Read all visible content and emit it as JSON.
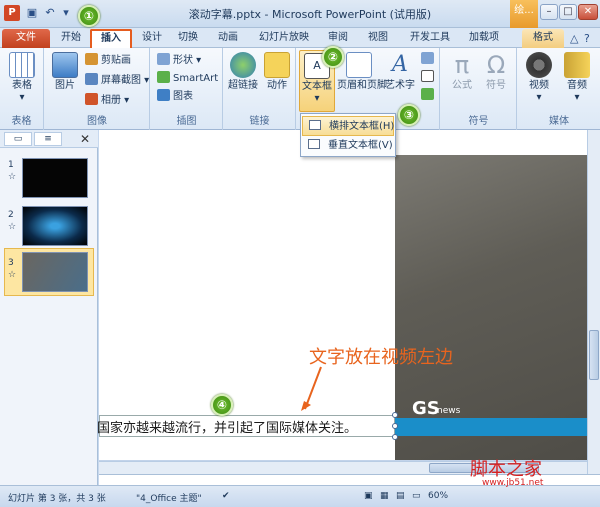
{
  "window": {
    "title": "滚动字幕.pptx - Microsoft PowerPoint (试用版)",
    "draw_tools_tab": "绘..."
  },
  "tabs": [
    "开始",
    "插入",
    "设计",
    "切换",
    "动画",
    "幻灯片放映",
    "审阅",
    "视图",
    "开发工具",
    "加载项",
    "格式"
  ],
  "file_tab": "文件",
  "ribbon": {
    "groups": {
      "tables": {
        "label": "表格",
        "table_btn": "表格"
      },
      "images": {
        "label": "图像",
        "picture_btn": "图片",
        "clipart_btn": "剪贴画",
        "screenshot_btn": "屏幕截图",
        "album_btn": "相册"
      },
      "illustrations": {
        "label": "插图",
        "shapes_btn": "形状",
        "smartart_btn": "SmartArt",
        "chart_btn": "图表"
      },
      "links": {
        "label": "链接",
        "hyperlink_btn": "超链接",
        "action_btn": "动作"
      },
      "text": {
        "textbox_btn": "文本框",
        "header_footer_btn": "页眉和页脚",
        "wordart_btn": "艺术字"
      },
      "symbols": {
        "label": "符号",
        "equation_btn": "公式",
        "symbol_btn": "符号"
      },
      "media": {
        "label": "媒体",
        "video_btn": "视频",
        "audio_btn": "音频"
      }
    }
  },
  "textbox_dropdown": {
    "horizontal": "横排文本框(H)",
    "vertical": "垂直文本框(V)"
  },
  "slides": [
    {
      "num": "1"
    },
    {
      "num": "2"
    },
    {
      "num": "3"
    }
  ],
  "slide": {
    "caption": "国家亦越来越流行，并引起了国际媒体关注。",
    "video_logo": "GS",
    "video_logo_sub": "news"
  },
  "annotation": "文字放在视频左边",
  "steps": [
    "①",
    "②",
    "③",
    "④"
  ],
  "status": {
    "slide_info": "幻灯片 第 3 张，共 3 张",
    "theme": "\"4_Office 主题\"",
    "zoom": "60%"
  },
  "watermark": {
    "text": "脚本之家",
    "url": "www.jb51.net"
  }
}
